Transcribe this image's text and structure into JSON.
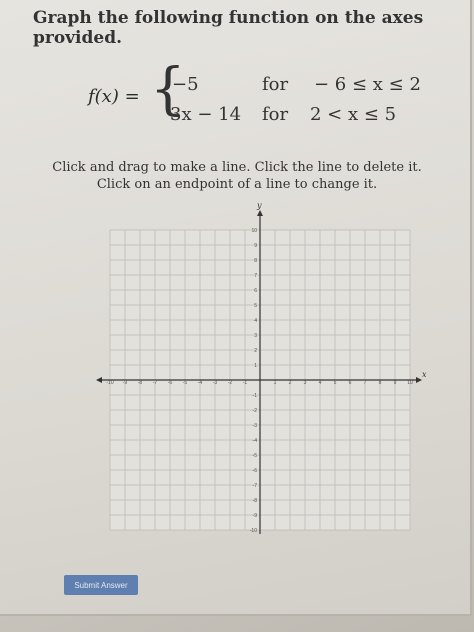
{
  "prompt": "Graph the following function on the axes provided.",
  "function": {
    "lhs": "f(x) =",
    "pieces": [
      {
        "expr": "−5",
        "for_label": "for",
        "condition": "− 6 ≤ x ≤ 2"
      },
      {
        "expr": "3x − 14",
        "for_label": "for",
        "condition": "2 < x ≤ 5"
      }
    ]
  },
  "instructions": {
    "line1": "Click and drag to make a line. Click the line to delete it.",
    "line2": "Click on an endpoint of a line to change it."
  },
  "graph": {
    "x_axis_label": "x",
    "y_axis_label": "y",
    "x_min": -10,
    "x_max": 10,
    "y_min": -10,
    "y_max": 10,
    "grid": true,
    "x_ticks": [
      "-10",
      "-9",
      "-8",
      "-7",
      "-6",
      "-5",
      "-4",
      "-3",
      "-2",
      "-1",
      "1",
      "2",
      "3",
      "4",
      "5",
      "6",
      "7",
      "8",
      "9",
      "10"
    ],
    "y_ticks": [
      "10",
      "9",
      "8",
      "7",
      "6",
      "5",
      "4",
      "3",
      "2",
      "1",
      "-1",
      "-2",
      "-3",
      "-4",
      "-5",
      "-6",
      "-7",
      "-8",
      "-9",
      "-10"
    ]
  },
  "buttons": {
    "submit": "Submit Answer"
  }
}
